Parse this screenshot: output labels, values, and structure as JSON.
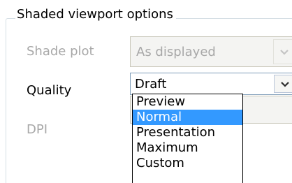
{
  "group": {
    "title": "Shaded viewport options"
  },
  "shade_plot": {
    "label": "Shade plot",
    "value": "As displayed",
    "enabled": false
  },
  "quality": {
    "label": "Quality",
    "value": "Draft",
    "options": [
      "Preview",
      "Normal",
      "Presentation",
      "Maximum",
      "Custom"
    ],
    "highlighted": "Normal"
  },
  "dpi": {
    "label": "DPI",
    "enabled": false
  },
  "icons": {
    "dropdown_arrow": "chevron-down-icon"
  },
  "colors": {
    "highlight": "#3399ff",
    "disabled_text": "#a8a8a8"
  }
}
